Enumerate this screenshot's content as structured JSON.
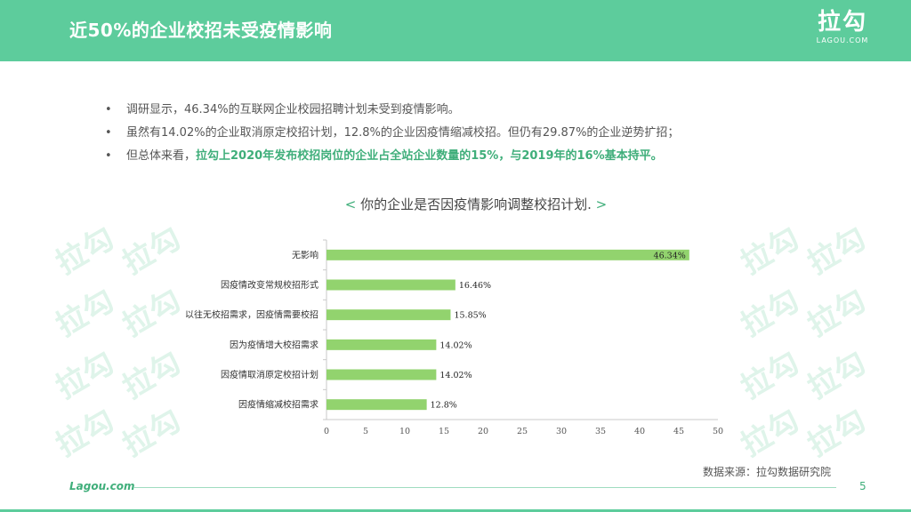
{
  "header": {
    "title": "近50%的企业校招未受疫情影响",
    "logo_cn": "拉勾",
    "logo_en": "LAGOU.COM"
  },
  "watermark_text": "拉勾",
  "bullets": {
    "b1": "调研显示，46.34%的互联网企业校园招聘计划未受到疫情影响。",
    "b2": "虽然有14.02%的企业取消原定校招计划，12.8%的企业因疫情缩减校招。但仍有29.87%的企业逆势扩招；",
    "b3_prefix": "但总体来看，",
    "b3_highlight": "拉勾上2020年发布校招岗位的企业占全站企业数量的15%，与2019年的16%基本持平。"
  },
  "chart_title": {
    "open": "<",
    "text": "你的企业是否因疫情影响调整校招计划.",
    "close": ">"
  },
  "chart_data": {
    "type": "bar",
    "orientation": "horizontal",
    "categories": [
      "无影响",
      "因疫情改变常规校招形式",
      "以往无校招需求，因疫情需要校招",
      "因为疫情增大校招需求",
      "因疫情取消原定校招计划",
      "因疫情缩减校招需求"
    ],
    "values": [
      46.34,
      16.46,
      15.85,
      14.02,
      14.02,
      12.8
    ],
    "value_labels": [
      "46.34%",
      "16.46%",
      "15.85%",
      "14.02%",
      "14.02%",
      "12.8%"
    ],
    "xlim": [
      0,
      50
    ],
    "xticks": [
      0,
      5,
      10,
      15,
      20,
      25,
      30,
      35,
      40,
      45,
      50
    ],
    "bar_color": "#92d36e",
    "grid": false
  },
  "source": "数据来源：拉勾数据研究院",
  "footer": {
    "brand": "Lagou.com",
    "page": "5"
  },
  "colors": {
    "accent": "#5dcc9c",
    "highlight": "#3fae7a"
  }
}
